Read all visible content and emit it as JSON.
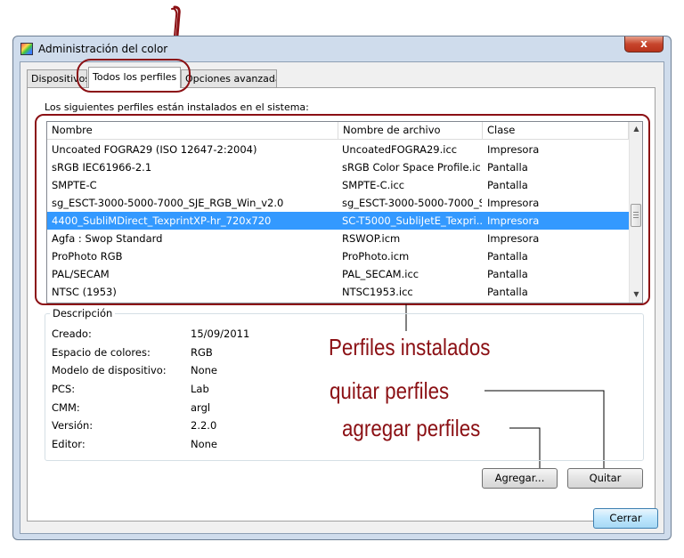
{
  "window": {
    "title": "Administración del color",
    "close_glyph": "x"
  },
  "tabs": [
    {
      "label": "Dispositivos"
    },
    {
      "label": "Todos los perfiles"
    },
    {
      "label": "Opciones avanzadas"
    }
  ],
  "profiles": {
    "caption": "Los siguientes perfiles están instalados en el sistema:",
    "columns": [
      "Nombre",
      "Nombre de archivo",
      "Clase"
    ],
    "rows": [
      {
        "name": "Uncoated FOGRA29 (ISO 12647-2:2004)",
        "file": "UncoatedFOGRA29.icc",
        "class": "Impresora"
      },
      {
        "name": "sRGB IEC61966-2.1",
        "file": "sRGB Color Space Profile.ic...",
        "class": "Pantalla"
      },
      {
        "name": "SMPTE-C",
        "file": "SMPTE-C.icc",
        "class": "Pantalla"
      },
      {
        "name": "sg_ESCT-3000-5000-7000_SJE_RGB_Win_v2.0",
        "file": "sg_ESCT-3000-5000-7000_S...",
        "class": "Impresora"
      },
      {
        "name": "4400_SubliMDirect_TexprintXP-hr_720x720",
        "file": "SC-T5000_SubliJetE_Texpri...",
        "class": "Impresora",
        "selected": true
      },
      {
        "name": "Agfa : Swop Standard",
        "file": "RSWOP.icm",
        "class": "Impresora"
      },
      {
        "name": "ProPhoto RGB",
        "file": "ProPhoto.icm",
        "class": "Pantalla"
      },
      {
        "name": "PAL/SECAM",
        "file": "PAL_SECAM.icc",
        "class": "Pantalla"
      },
      {
        "name": "NTSC (1953)",
        "file": "NTSC1953.icc",
        "class": "Pantalla"
      }
    ]
  },
  "description": {
    "legend": "Descripción",
    "fields": [
      {
        "label": "Creado:",
        "value": "15/09/2011"
      },
      {
        "label": "Espacio de colores:",
        "value": "RGB"
      },
      {
        "label": "Modelo de dispositivo:",
        "value": "None"
      },
      {
        "label": "PCS:",
        "value": "Lab"
      },
      {
        "label": "CMM:",
        "value": "argl"
      },
      {
        "label": "Versión:",
        "value": "2.2.0"
      },
      {
        "label": "Editor:",
        "value": "None"
      }
    ]
  },
  "annotations": {
    "installed": "Perfiles instalados",
    "remove": "quitar perfiles",
    "add": "agregar perfiles",
    "color": "#8b1014"
  },
  "buttons": {
    "add": "Agregar...",
    "remove": "Quitar",
    "close": "Cerrar"
  },
  "colors": {
    "selection": "#3399ff",
    "frame": "#cfdcec"
  }
}
